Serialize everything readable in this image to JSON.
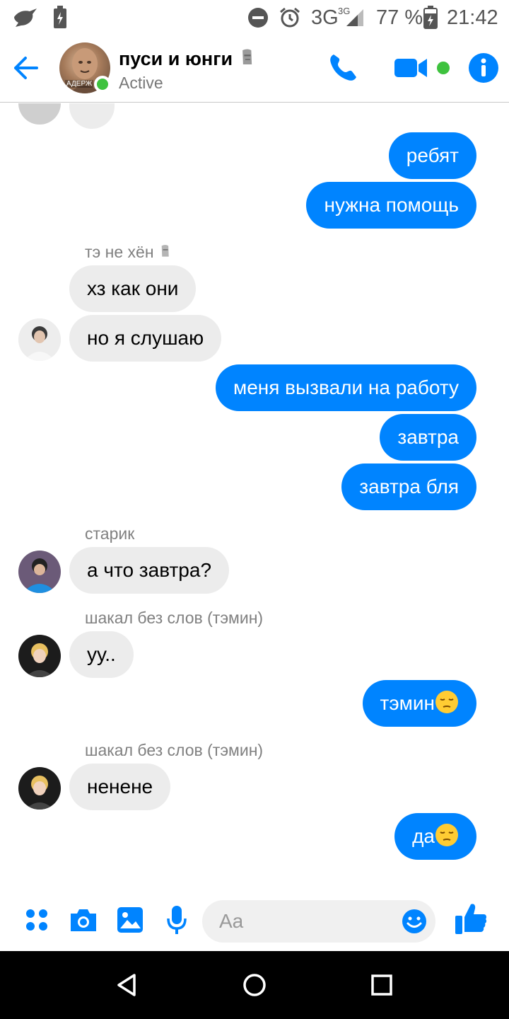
{
  "status_bar": {
    "network": "3G",
    "network_small": "3G",
    "battery_percent": "77 %",
    "time": "21:42",
    "icons": [
      "bird-icon",
      "battery-saver-icon",
      "do-not-disturb-icon",
      "alarm-icon",
      "signal-icon",
      "battery-icon"
    ]
  },
  "header": {
    "title": "пуси и юнги",
    "title_emoji": "moai-emoji",
    "status": "Active",
    "avatar_caption": "АДЕРЖ",
    "buttons": [
      "back-arrow-icon",
      "phone-icon",
      "video-camera-icon",
      "info-icon"
    ],
    "accent": "#0084ff",
    "online_color": "#3ec23e"
  },
  "messages": [
    {
      "side": "out",
      "text": "ребят"
    },
    {
      "side": "out",
      "text": "нужна помощь"
    },
    {
      "side": "in",
      "sender": "тэ не хён",
      "sender_emoji": "moai-emoji",
      "text": "хз как они"
    },
    {
      "side": "in",
      "text": "но я слушаю"
    },
    {
      "side": "out",
      "text": "меня вызвали на работу"
    },
    {
      "side": "out",
      "text": "завтра"
    },
    {
      "side": "out",
      "text": "завтра бля"
    },
    {
      "side": "in",
      "sender": "старик",
      "text": "а что завтра?"
    },
    {
      "side": "in",
      "sender": "шакал без слов (тэмин)",
      "text": "уу.."
    },
    {
      "side": "out",
      "text": "тэмин",
      "emoji": "pensive-face-emoji"
    },
    {
      "side": "in",
      "sender": "шакал без слов (тэмин)",
      "text": "ненене"
    },
    {
      "side": "out",
      "text": "да",
      "emoji": "pensive-face-emoji"
    }
  ],
  "composer": {
    "placeholder": "Aa",
    "icons": [
      "apps-grid-icon",
      "camera-icon",
      "gallery-icon",
      "microphone-icon",
      "emoji-smile-icon",
      "thumbs-up-icon"
    ]
  },
  "colors": {
    "outgoing_bubble": "#0084ff",
    "incoming_bubble": "#ececec",
    "sender_text": "#808080"
  }
}
